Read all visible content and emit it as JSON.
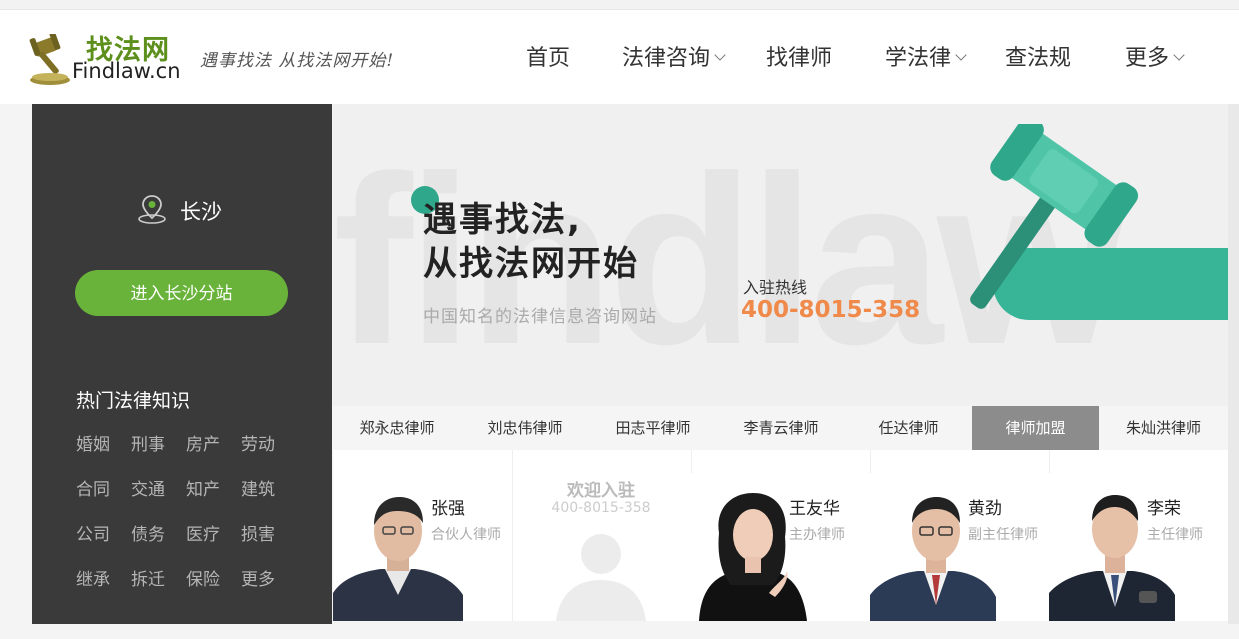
{
  "header": {
    "logo_cn": "找法网",
    "logo_en": "Findlaw.cn",
    "slogan": "遇事找法 从找法网开始!"
  },
  "nav": [
    {
      "label": "首页",
      "has_dropdown": false
    },
    {
      "label": "法律咨询",
      "has_dropdown": true
    },
    {
      "label": "找律师",
      "has_dropdown": false
    },
    {
      "label": "学法律",
      "has_dropdown": true
    },
    {
      "label": "查法规",
      "has_dropdown": false
    },
    {
      "label": "更多",
      "has_dropdown": true
    }
  ],
  "sidebar": {
    "city": "长沙",
    "enter_button": "进入长沙分站",
    "hot_title": "热门法律知识",
    "topics": [
      "婚姻",
      "刑事",
      "房产",
      "劳动",
      "合同",
      "交通",
      "知产",
      "建筑",
      "公司",
      "债务",
      "医疗",
      "损害",
      "继承",
      "拆迁",
      "保险",
      "更多"
    ]
  },
  "banner": {
    "watermark": "findlaw",
    "headline_1": "遇事找法,",
    "headline_2": "从找法网开始",
    "subtitle": "中国知名的法律信息咨询网站",
    "hotline_label": "入驻热线",
    "hotline": "400-8015-358"
  },
  "tabs": [
    "郑永忠律师",
    "刘忠伟律师",
    "田志平律师",
    "李青云律师",
    "任达律师",
    "律师加盟",
    "朱灿洪律师"
  ],
  "active_tab": "律师加盟",
  "cards": {
    "c1": {
      "name": "张强",
      "role": "合伙人律师"
    },
    "welcome": {
      "title": "欢迎入驻",
      "phone": "400-8015-358"
    },
    "c3": {
      "name": "王友华",
      "role": "主办律师"
    },
    "c4": {
      "name": "黄劲",
      "role": "副主任律师"
    },
    "c5": {
      "name": "李荣",
      "role": "主任律师"
    }
  },
  "colors": {
    "accent_green": "#69b33a",
    "teal": "#37b596",
    "hotline_orange": "#f08a4b",
    "sidebar_bg": "#3a3a3a"
  }
}
